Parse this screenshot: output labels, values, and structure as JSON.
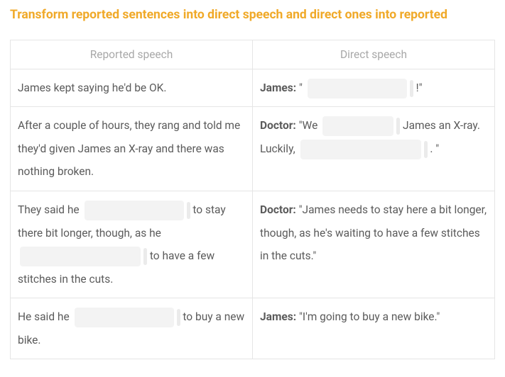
{
  "title": "Transform reported sentences into direct speech and direct ones into reported",
  "headers": {
    "reported": "Reported speech",
    "direct": "Direct speech"
  },
  "rows": [
    {
      "reported_text": "James kept saying he'd be OK.",
      "direct_speaker": "James:",
      "direct_before": "\"",
      "direct_after": "!\""
    },
    {
      "reported_text": "After a couple of hours, they rang and told me they'd given James an X-ray and there was nothing broken.",
      "direct_speaker": "Doctor:",
      "direct_before": "\"We",
      "direct_mid": "James an X-ray. Luckily,",
      "direct_after": ". \""
    },
    {
      "reported_before": "They said he",
      "reported_mid": "to stay there bit longer, though, as he",
      "reported_after": "to have a few stitches in the cuts.",
      "direct_speaker": "Doctor:",
      "direct_text": "\"James needs to stay here a bit longer, though, as he's waiting to have a few stitches in the cuts.\""
    },
    {
      "reported_before": "He said he",
      "reported_after": "to buy a new bike.",
      "direct_speaker": "James:",
      "direct_text": "\"I'm going to buy a new bike.\""
    }
  ]
}
